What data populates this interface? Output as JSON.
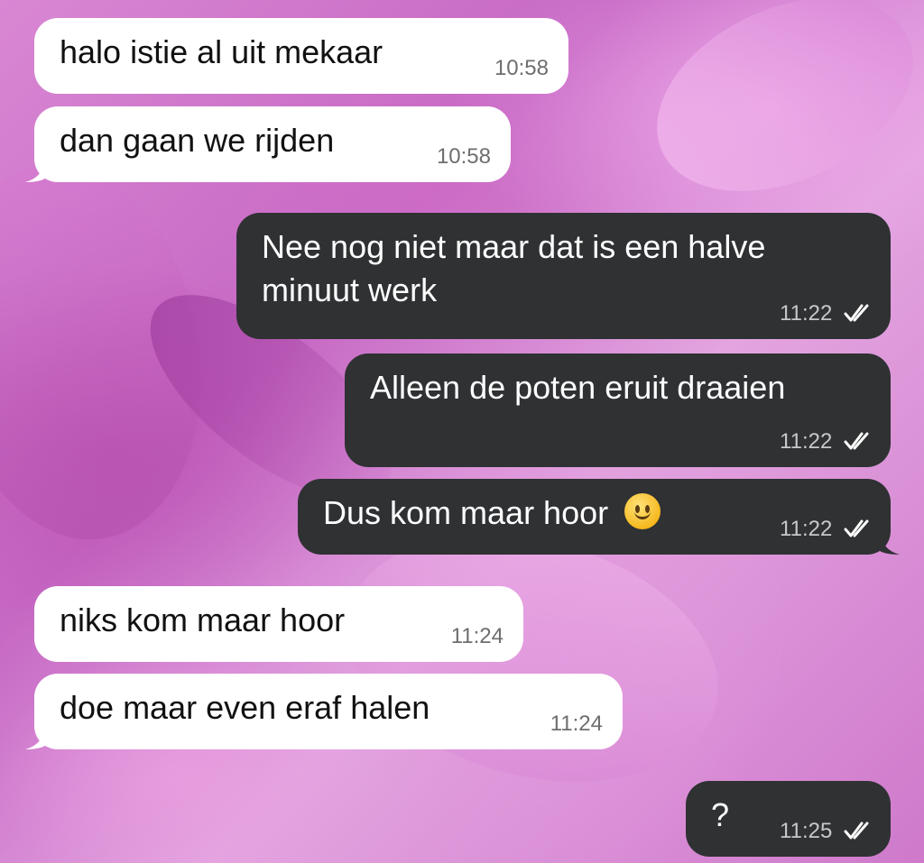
{
  "messages": [
    {
      "text": "halo istie al uit mekaar",
      "time": "10:58"
    },
    {
      "text": "dan gaan we rijden",
      "time": "10:58"
    },
    {
      "line1": "Nee nog niet maar dat is een halve",
      "line2": "minuut werk",
      "time": "11:22",
      "status": "read-double-check-icon"
    },
    {
      "text": "Alleen de poten eruit draaien",
      "time": "11:22",
      "status": "read-double-check-icon"
    },
    {
      "text": "Dus kom maar hoor",
      "emoji": "slightly-smiling-face-icon",
      "time": "11:22",
      "status": "read-double-check-icon"
    },
    {
      "text": "niks kom maar hoor",
      "time": "11:24"
    },
    {
      "text": "doe maar even eraf halen",
      "time": "11:24"
    },
    {
      "text": "?",
      "time": "11:25",
      "status": "read-double-check-icon"
    }
  ],
  "colors": {
    "incoming_bubble": "#ffffff",
    "outgoing_bubble": "#2f3133",
    "wallpaper": "#d987d3"
  }
}
